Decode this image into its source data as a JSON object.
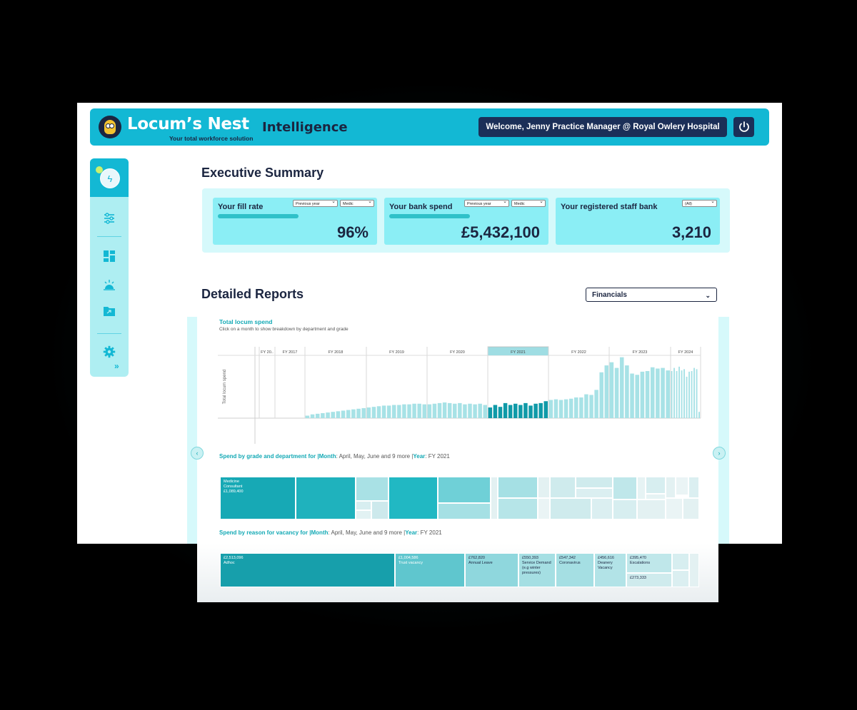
{
  "header": {
    "brand": "Locum’s Nest",
    "tagline": "Your total workforce solution",
    "app_title": "Intelligence",
    "welcome": "Welcome, Jenny Practice Manager @ Royal Owlery Hospital",
    "power_icon": "power-icon",
    "color": "#13b8d4"
  },
  "sidebar": {
    "items": [
      {
        "icon": "sliders-icon"
      },
      {
        "icon": "dashboard-icon"
      },
      {
        "icon": "sunrise-icon"
      },
      {
        "icon": "folder-icon"
      },
      {
        "icon": "gear-icon"
      }
    ],
    "expand": "»"
  },
  "executive_summary": {
    "title": "Executive Summary",
    "cards": [
      {
        "label": "Your fill rate",
        "value": "96%",
        "filter1": "Previous year",
        "filter2": "Medic"
      },
      {
        "label": "Your bank spend",
        "value": "£5,432,100",
        "filter1": "Previous year",
        "filter2": "Medic"
      },
      {
        "label": "Your registered staff bank",
        "value": "3,210",
        "filter1": "(All)"
      }
    ]
  },
  "detailed_reports": {
    "title": "Detailed Reports",
    "selected_report": "Financials",
    "chart_title": "Total locum spend",
    "chart_subtitle": "Click on a month to show breakdown by department and grade",
    "grade_title": {
      "label": "Spend by grade and department for |",
      "month_key": "Month",
      "month_val": ": April, May, June and 9 more |",
      "year_key": "Year",
      "year_val": ": FY 2021"
    },
    "reason_title": {
      "label": "Spend by reason for vacancy for |",
      "month_key": "Month",
      "month_val": ": April, May, June and 9 more |",
      "year_key": "Year",
      "year_val": ": FY 2021"
    },
    "grade_treemap_label": [
      "Medicine",
      "Consultant",
      "£1,089,400"
    ],
    "reasons": [
      {
        "amount": "£2,513,096",
        "name": "Adhoc"
      },
      {
        "amount": "£1,004,586",
        "name": "Trust vacancy"
      },
      {
        "amount": "£762,820",
        "name": "Annual Leave"
      },
      {
        "amount": "£550,393",
        "name": "Service Demand (e.g winter pressures)"
      },
      {
        "amount": "£547,342",
        "name": "Coronavirus"
      },
      {
        "amount": "£456,616",
        "name": "Deanery Vacancy"
      },
      {
        "amount": "£395,470",
        "name": "Escalations"
      },
      {
        "amount": "£273,333",
        "name": ""
      }
    ]
  },
  "chart_data": {
    "type": "bar",
    "title": "Total locum spend",
    "ylabel": "Total locum spend",
    "years": [
      "FY 20..",
      "FY 2017",
      "FY 2018",
      "FY 2019",
      "FY 2020",
      "FY 2021",
      "FY 2022",
      "FY 2023",
      "FY 2024"
    ],
    "selected_year": "FY 2021",
    "values_by_year": [
      [],
      [],
      [
        0.04,
        0.06,
        0.07,
        0.08,
        0.09,
        0.1,
        0.11,
        0.12,
        0.13,
        0.14,
        0.15,
        0.16
      ],
      [
        0.17,
        0.18,
        0.19,
        0.2,
        0.2,
        0.21,
        0.21,
        0.22,
        0.22,
        0.23,
        0.23,
        0.22
      ],
      [
        0.22,
        0.23,
        0.24,
        0.25,
        0.24,
        0.23,
        0.24,
        0.22,
        0.23,
        0.22,
        0.23,
        0.21
      ],
      [
        0.17,
        0.21,
        0.18,
        0.24,
        0.21,
        0.23,
        0.21,
        0.24,
        0.2,
        0.23,
        0.24,
        0.27
      ],
      [
        0.29,
        0.3,
        0.29,
        0.3,
        0.31,
        0.33,
        0.33,
        0.38,
        0.37,
        0.45,
        0.73,
        0.84
      ],
      [
        0.89,
        0.8,
        0.97,
        0.84,
        0.71,
        0.69,
        0.74,
        0.75,
        0.81,
        0.79,
        0.8,
        0.76
      ],
      [
        0.75,
        0.8,
        0.75,
        0.82,
        0.76,
        0.78,
        0.66,
        0.74,
        0.75,
        0.8,
        0.78,
        0.1
      ]
    ],
    "colors": {
      "bar": "#a7e2e6",
      "selected": "#0f9aa8",
      "band": "#9fdde3"
    }
  }
}
